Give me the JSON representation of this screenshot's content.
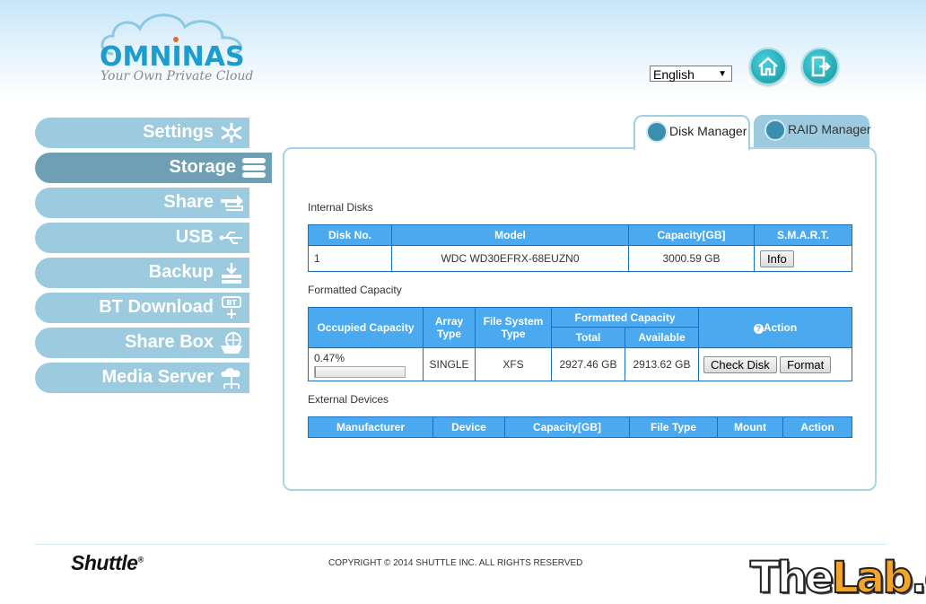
{
  "header": {
    "brand": "OMNINAS",
    "tagline": "Your Own Private Cloud",
    "language": "English",
    "home_icon": "home-icon",
    "logout_icon": "logout-icon"
  },
  "sidebar": {
    "items": [
      {
        "label": "Settings",
        "icon": "settings-icon"
      },
      {
        "label": "Storage",
        "icon": "storage-icon",
        "active": true
      },
      {
        "label": "Share",
        "icon": "share-icon"
      },
      {
        "label": "USB",
        "icon": "usb-icon"
      },
      {
        "label": "Backup",
        "icon": "backup-icon"
      },
      {
        "label": "BT Download",
        "icon": "bt-download-icon"
      },
      {
        "label": "Share Box",
        "icon": "share-box-icon"
      },
      {
        "label": "Media Server",
        "icon": "media-server-icon"
      }
    ]
  },
  "tabs": [
    {
      "label": "Disk Manager",
      "active": true
    },
    {
      "label": "RAID Manager",
      "active": false
    }
  ],
  "internal_disks": {
    "title": "Internal Disks",
    "headers": [
      "Disk No.",
      "Model",
      "Capacity[GB]",
      "S.M.A.R.T."
    ],
    "rows": [
      {
        "disk_no": "1",
        "model": "WDC WD30EFRX-68EUZN0",
        "capacity": "3000.59 GB",
        "smart_button": "Info"
      }
    ]
  },
  "formatted_capacity": {
    "title": "Formatted Capacity",
    "headers": {
      "occupied": "Occupied Capacity",
      "array_type": "Array Type",
      "fs_type": "File System Type",
      "formatted": "Formatted Capacity",
      "total": "Total",
      "available": "Available",
      "action": "Action"
    },
    "rows": [
      {
        "occupied": "0.47%",
        "occupied_fraction": 0.0047,
        "array_type": "SINGLE",
        "fs_type": "XFS",
        "total": "2927.46 GB",
        "available": "2913.62 GB",
        "check_disk": "Check Disk",
        "format": "Format"
      }
    ]
  },
  "external_devices": {
    "title": "External Devices",
    "headers": [
      "Manufacturer",
      "Device",
      "Capacity[GB]",
      "File Type",
      "Mount",
      "Action"
    ]
  },
  "footer": {
    "shuttle": "Shuttle",
    "copyright": "COPYRIGHT © 2014 SHUTTLE INC. ALL RIGHTS RESERVED",
    "watermark_a": "The",
    "watermark_b": "Lab",
    "watermark_c": ".gr"
  }
}
